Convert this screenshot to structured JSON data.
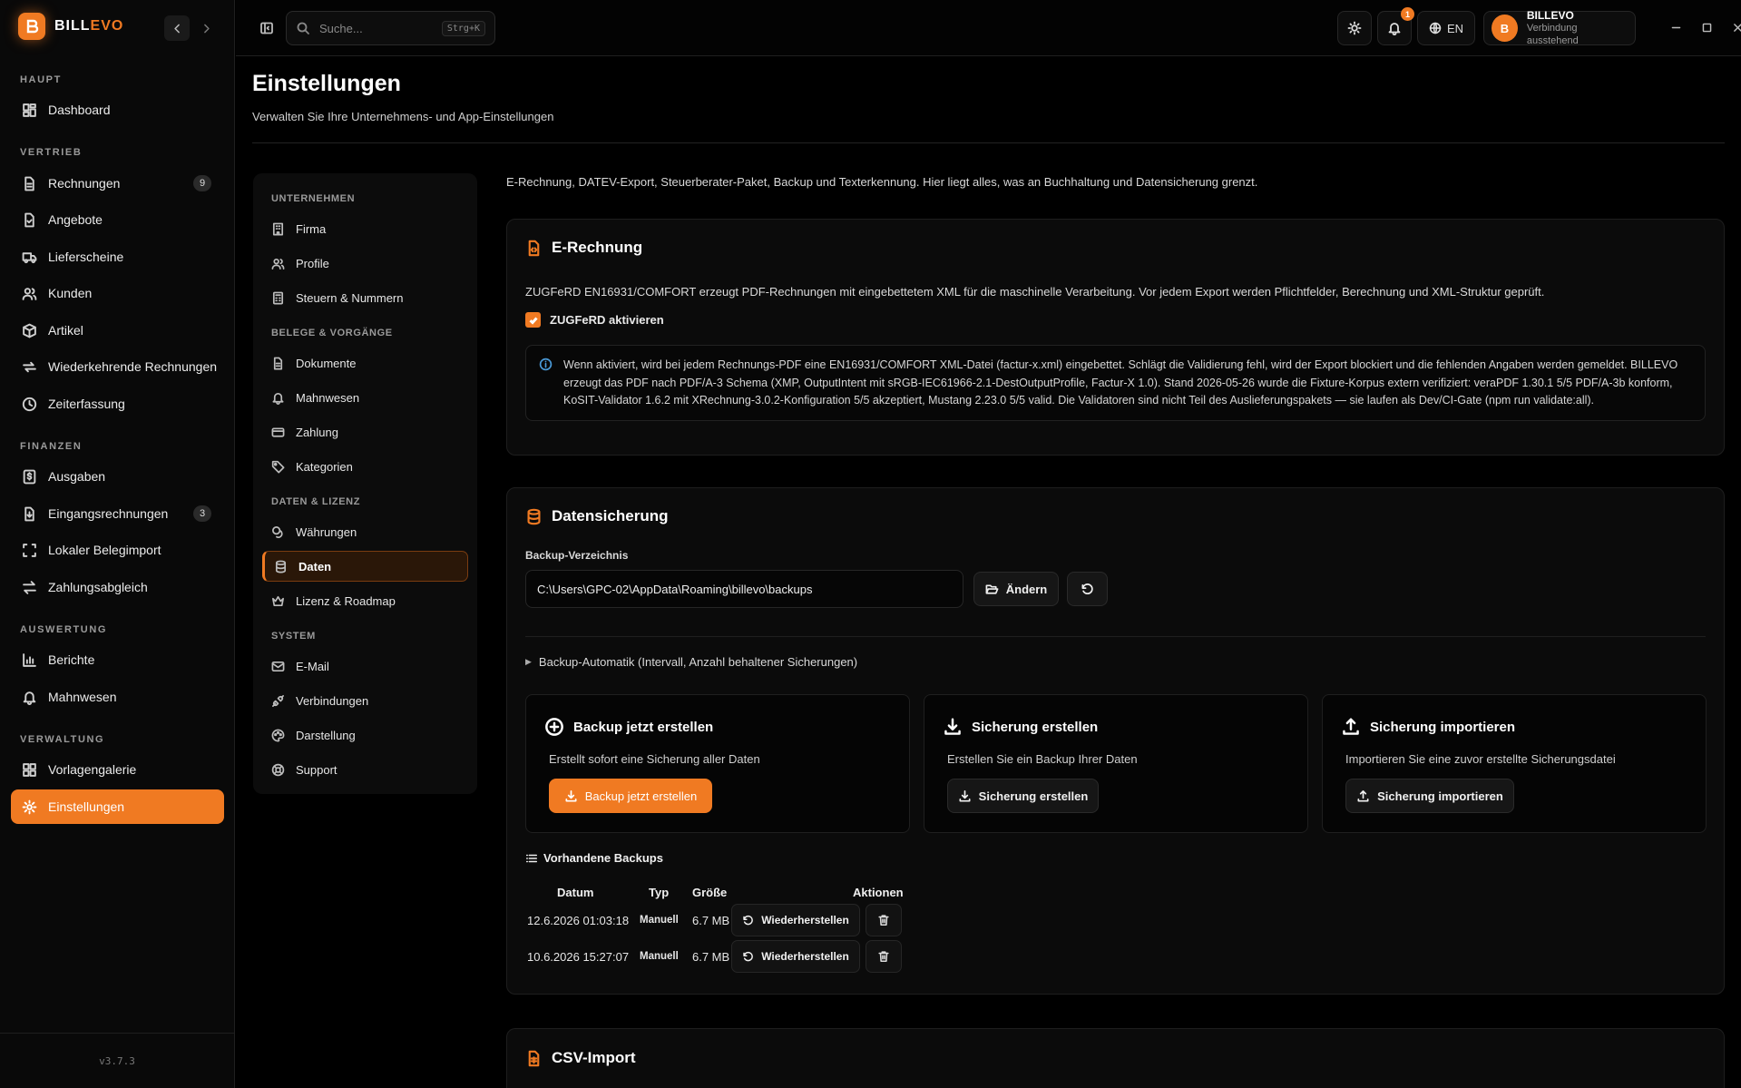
{
  "app": {
    "name_a": "BILL",
    "name_b": "EVO",
    "version": "v3.7.3"
  },
  "sidebar": {
    "sections": [
      {
        "label": "HAUPT"
      },
      {
        "label": "VERTRIEB"
      },
      {
        "label": "FINANZEN"
      },
      {
        "label": "AUSWERTUNG"
      },
      {
        "label": "VERWALTUNG"
      }
    ],
    "items": [
      {
        "label": "Dashboard",
        "icon": "dashboard-icon"
      },
      {
        "label": "Rechnungen",
        "icon": "file-icon",
        "count": "9"
      },
      {
        "label": "Angebote",
        "icon": "file-check-icon"
      },
      {
        "label": "Lieferscheine",
        "icon": "truck-icon"
      },
      {
        "label": "Kunden",
        "icon": "users-icon"
      },
      {
        "label": "Artikel",
        "icon": "package-icon"
      },
      {
        "label": "Wiederkehrende Rechnungen",
        "icon": "repeat-icon"
      },
      {
        "label": "Zeiterfassung",
        "icon": "clock-icon"
      },
      {
        "label": "Ausgaben",
        "icon": "receipt-icon"
      },
      {
        "label": "Eingangsrechnungen",
        "icon": "inbox-icon",
        "count": "3"
      },
      {
        "label": "Lokaler Belegimport",
        "icon": "scan-icon"
      },
      {
        "label": "Zahlungsabgleich",
        "icon": "arrows-icon"
      },
      {
        "label": "Berichte",
        "icon": "chart-icon"
      },
      {
        "label": "Mahnwesen",
        "icon": "bell-icon"
      },
      {
        "label": "Vorlagengalerie",
        "icon": "layout-icon"
      },
      {
        "label": "Einstellungen",
        "icon": "gear-icon"
      }
    ]
  },
  "topbar": {
    "search_placeholder": "Suche...",
    "search_shortcut": "Strg+K",
    "notification_count": "1",
    "language": "EN",
    "user_initial": "B",
    "user_name": "BILLEVO",
    "user_status": "Verbindung ausstehend"
  },
  "page": {
    "title": "Einstellungen",
    "subtitle": "Verwalten Sie Ihre Unternehmens- und App-Einstellungen"
  },
  "settings_nav": {
    "sections": [
      {
        "label": "UNTERNEHMEN"
      },
      {
        "label": "BELEGE & VORGÄNGE"
      },
      {
        "label": "DATEN & LIZENZ"
      },
      {
        "label": "SYSTEM"
      }
    ],
    "items": [
      {
        "label": "Firma"
      },
      {
        "label": "Profile"
      },
      {
        "label": "Steuern & Nummern"
      },
      {
        "label": "Dokumente"
      },
      {
        "label": "Mahnwesen"
      },
      {
        "label": "Zahlung"
      },
      {
        "label": "Kategorien"
      },
      {
        "label": "Währungen"
      },
      {
        "label": "Daten"
      },
      {
        "label": "Lizenz & Roadmap"
      },
      {
        "label": "E-Mail"
      },
      {
        "label": "Verbindungen"
      },
      {
        "label": "Darstellung"
      },
      {
        "label": "Support"
      }
    ]
  },
  "content": {
    "intro": "E-Rechnung, DATEV-Export, Steuerberater-Paket, Backup und Texterkennung. Hier liegt alles, was an Buchhaltung und Datensicherung grenzt.",
    "erechnung": {
      "title": "E-Rechnung",
      "description": "ZUGFeRD EN16931/COMFORT erzeugt PDF-Rechnungen mit eingebettetem XML für die maschinelle Verarbeitung. Vor jedem Export werden Pflichtfelder, Berechnung und XML-Struktur geprüft.",
      "checkbox_label": "ZUGFeRD aktivieren",
      "checkbox_checked": true,
      "info_line1": "Wenn aktiviert, wird bei jedem Rechnungs-PDF eine EN16931/COMFORT XML-Datei (factur-x.xml) eingebettet. Schlägt die Validierung fehl, wird der Export blockiert und die fehlenden Angaben werden gemeldet. BILLEVO",
      "info_line2": "erzeugt das PDF nach PDF/A-3 Schema (XMP, OutputIntent mit sRGB-IEC61966-2.1-DestOutputProfile, Factur-X 1.0). Stand 2026-05-26 wurde die Fixture-Korpus extern verifiziert: veraPDF 1.30.1 5/5 PDF/A-3b konform,",
      "info_line3": "KoSIT-Validator 1.6.2 mit XRechnung-3.0.2-Konfiguration 5/5 akzeptiert, Mustang 2.23.0 5/5 valid. Die Validatoren sind nicht Teil des Auslieferungspakets — sie laufen als Dev/CI-Gate (npm run validate:all)."
    },
    "datensicherung": {
      "title": "Datensicherung",
      "dir_label": "Backup-Verzeichnis",
      "dir_value": "C:\\Users\\GPC-02\\AppData\\Roaming\\billevo\\backups",
      "change_label": "Ändern",
      "automatic_label": "Backup-Automatik (Intervall, Anzahl behaltener Sicherungen)",
      "cards": [
        {
          "title": "Backup jetzt erstellen",
          "desc": "Erstellt sofort eine Sicherung aller Daten",
          "button": "Backup jetzt erstellen"
        },
        {
          "title": "Sicherung erstellen",
          "desc": "Erstellen Sie ein Backup Ihrer Daten",
          "button": "Sicherung erstellen"
        },
        {
          "title": "Sicherung importieren",
          "desc": "Importieren Sie eine zuvor erstellte Sicherungsdatei",
          "button": "Sicherung importieren"
        }
      ],
      "list_title": "Vorhandene Backups",
      "columns": [
        "Datum",
        "Typ",
        "Größe",
        "Aktionen"
      ],
      "rows": [
        {
          "datum": "12.6.2026 01:03:18",
          "typ": "Manuell",
          "groesse": "6.7 MB",
          "restore": "Wiederherstellen"
        },
        {
          "datum": "10.6.2026 15:27:07",
          "typ": "Manuell",
          "groesse": "6.7 MB",
          "restore": "Wiederherstellen"
        }
      ]
    },
    "csv": {
      "title": "CSV-Import"
    }
  },
  "colors": {
    "accent": "#f07a22",
    "background": "#000000",
    "surface": "#0b0b0b",
    "info": "#4a9ad8"
  }
}
